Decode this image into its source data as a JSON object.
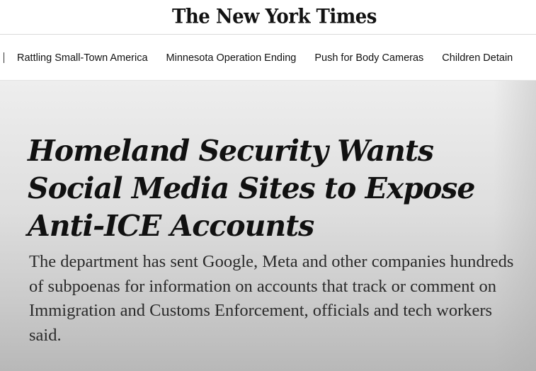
{
  "masthead": {
    "logo": "The New York Times"
  },
  "topics": [
    {
      "label": "Rattling Small-Town America"
    },
    {
      "label": "Minnesota Operation Ending"
    },
    {
      "label": "Push for Body Cameras"
    },
    {
      "label": "Children Detain"
    }
  ],
  "article": {
    "headline": "Homeland Security Wants Social Media Sites to Expose Anti-ICE Accounts",
    "summary": "The department has sent Google, Meta and other companies hundreds of subpoenas for information on accounts that track or comment on Immigration and Customs Enforcement, officials and tech workers said."
  }
}
